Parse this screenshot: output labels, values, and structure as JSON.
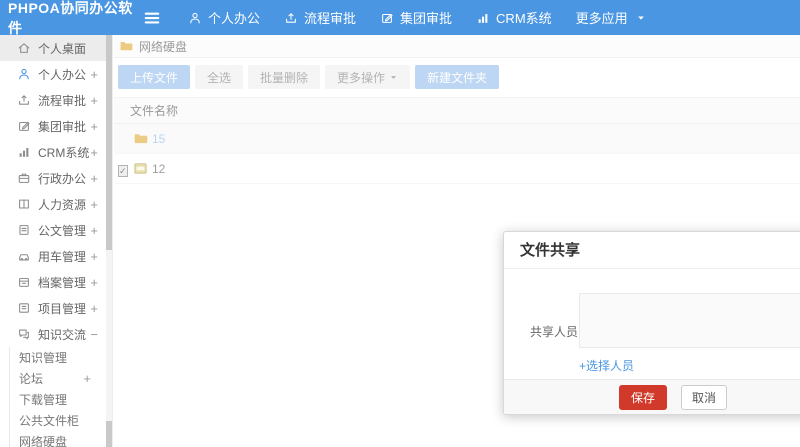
{
  "navbar": {
    "logo": "PHPOA协同办公软件",
    "items": [
      {
        "label": "个人办公",
        "icon": "person-icon"
      },
      {
        "label": "流程审批",
        "icon": "flow-icon"
      },
      {
        "label": "集团审批",
        "icon": "edit-icon"
      },
      {
        "label": "CRM系统",
        "icon": "chart-icon"
      },
      {
        "label": "更多应用",
        "icon": "",
        "caret": true
      }
    ]
  },
  "sidebar": {
    "items": [
      {
        "label": "个人桌面",
        "icon": "home-icon",
        "expander": "",
        "active": true
      },
      {
        "label": "个人办公",
        "icon": "person-icon",
        "expander": "+",
        "iconBlue": true
      },
      {
        "label": "流程审批",
        "icon": "flow-icon",
        "expander": "+"
      },
      {
        "label": "集团审批",
        "icon": "edit-icon",
        "expander": "+"
      },
      {
        "label": "CRM系统",
        "icon": "chart-icon",
        "expander": "+"
      },
      {
        "label": "行政办公",
        "icon": "briefcase-icon",
        "expander": "+"
      },
      {
        "label": "人力资源",
        "icon": "book-icon",
        "expander": "+"
      },
      {
        "label": "公文管理",
        "icon": "doc-icon",
        "expander": "+"
      },
      {
        "label": "用车管理",
        "icon": "car-icon",
        "expander": "+"
      },
      {
        "label": "档案管理",
        "icon": "archive-icon",
        "expander": "+"
      },
      {
        "label": "项目管理",
        "icon": "project-icon",
        "expander": "+"
      },
      {
        "label": "知识交流",
        "icon": "chat-icon",
        "expander": "−"
      }
    ],
    "submenu": [
      {
        "label": "知识管理",
        "expander": ""
      },
      {
        "label": "论坛",
        "expander": "+"
      },
      {
        "label": "下载管理",
        "expander": ""
      },
      {
        "label": "公共文件柜",
        "expander": ""
      },
      {
        "label": "网络硬盘",
        "expander": ""
      }
    ]
  },
  "breadcrumb": {
    "label": "网络硬盘"
  },
  "toolbar": {
    "buttons": [
      {
        "label": "上传文件",
        "style": "primary"
      },
      {
        "label": "全选",
        "style": "default"
      },
      {
        "label": "批量删除",
        "style": "default"
      },
      {
        "label": "更多操作",
        "style": "default",
        "caret": true
      },
      {
        "label": "新建文件夹",
        "style": "primary"
      }
    ]
  },
  "file_table": {
    "header": "文件名称",
    "rows": [
      {
        "name": "15",
        "icon": "folder-icon",
        "type": "folder",
        "checked": false
      },
      {
        "name": "12",
        "icon": "file-icon",
        "type": "file",
        "checked": true
      }
    ]
  },
  "modal": {
    "title": "文件共享",
    "share_label": "共享人员",
    "share_value": "",
    "select_link": "+选择人员",
    "save_label": "保存",
    "cancel_label": "取消"
  },
  "colors": {
    "navbar_blue": "#4a96e2",
    "primary_light": "#bcd6f3",
    "save_red": "#d13a2a",
    "folder_yellow": "#eccb84"
  }
}
